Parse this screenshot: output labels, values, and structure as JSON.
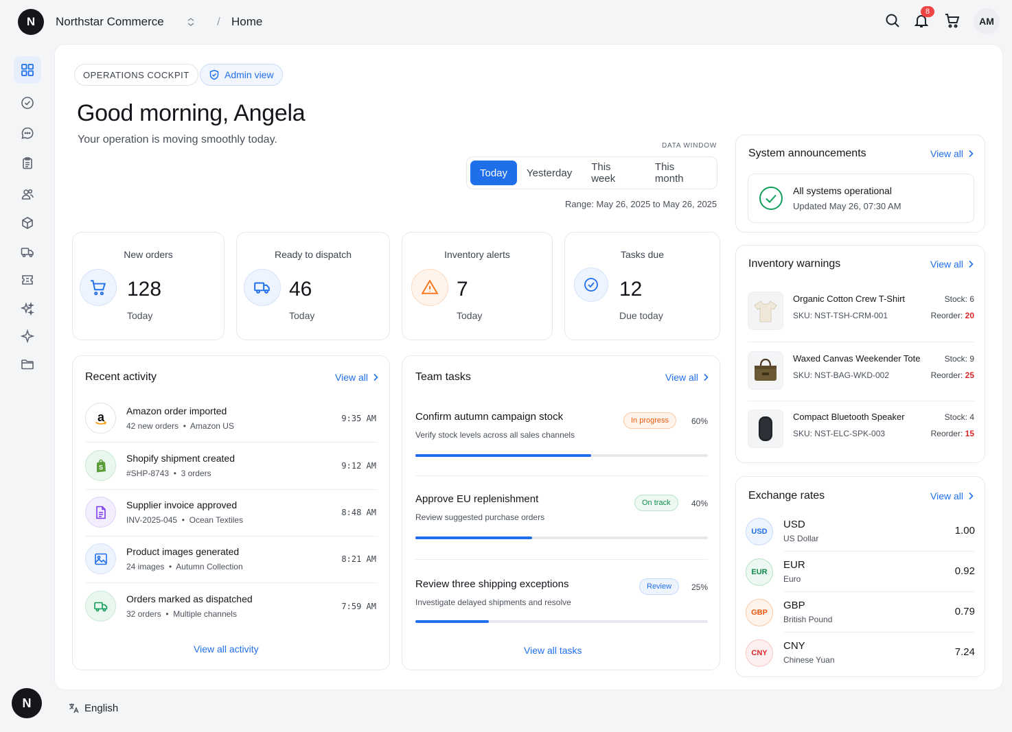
{
  "topbar": {
    "logo_letter": "N",
    "brand": "Northstar Commerce",
    "crumb_sep": "/",
    "crumb": "Home",
    "notif_count": "8",
    "avatar": "AM"
  },
  "sidebar": {
    "items": [
      {
        "icon": "dashboard-icon",
        "active": true
      },
      {
        "icon": "check-circle-icon"
      },
      {
        "icon": "chat-icon"
      },
      {
        "icon": "clipboard-icon"
      },
      {
        "icon": "users-icon"
      },
      {
        "icon": "box-icon"
      },
      {
        "icon": "truck-icon"
      },
      {
        "icon": "ticket-icon"
      },
      {
        "icon": "sparkles-icon"
      },
      {
        "icon": "sparkle-icon"
      },
      {
        "icon": "folder-icon"
      }
    ],
    "footer_logo": "N",
    "language": "English"
  },
  "header": {
    "ops_pill": "OPERATIONS COCKPIT",
    "admin_pill": "Admin view",
    "greeting": "Good morning, Angela",
    "subtitle": "Your operation is moving smoothly today.",
    "data_window_label": "DATA WINDOW",
    "tabs": [
      "Today",
      "Yesterday",
      "This week",
      "This month"
    ],
    "active_tab": "Today",
    "range": "Range: May 26, 2025 to May 26, 2025"
  },
  "stats": [
    {
      "label": "New orders",
      "value": "128",
      "foot": "Today",
      "icon": "cart-icon",
      "color": "#1f6feb"
    },
    {
      "label": "Ready to dispatch",
      "value": "46",
      "foot": "Today",
      "icon": "truck-icon",
      "color": "#1f6feb"
    },
    {
      "label": "Inventory alerts",
      "value": "7",
      "foot": "Today",
      "icon": "warning-icon",
      "color": "#f97316"
    },
    {
      "label": "Tasks due",
      "value": "12",
      "foot": "Due today",
      "icon": "check-circle-icon",
      "color": "#1f6feb"
    }
  ],
  "activity": {
    "title": "Recent activity",
    "view_all": "View all",
    "items": [
      {
        "title": "Amazon order imported",
        "meta1": "42 new orders",
        "meta2": "Amazon US",
        "time": "9:35 AM",
        "icon": "amazon-icon"
      },
      {
        "title": "Shopify shipment created",
        "meta1": "#SHP-8743",
        "meta2": "3 orders",
        "time": "9:12 AM",
        "icon": "shopify-icon"
      },
      {
        "title": "Supplier invoice approved",
        "meta1": "INV-2025-045",
        "meta2": "Ocean Textiles",
        "time": "8:48 AM",
        "icon": "document-icon"
      },
      {
        "title": "Product images generated",
        "meta1": "24 images",
        "meta2": "Autumn Collection",
        "time": "8:21 AM",
        "icon": "image-icon"
      },
      {
        "title": "Orders marked as dispatched",
        "meta1": "32 orders",
        "meta2": "Multiple channels",
        "time": "7:59 AM",
        "icon": "truck-icon"
      }
    ],
    "footer_link": "View all activity"
  },
  "tasks": {
    "title": "Team tasks",
    "view_all": "View all",
    "items": [
      {
        "title": "Confirm autumn campaign stock",
        "desc": "Verify stock levels across all sales channels",
        "badge": "In progress",
        "pct": "60%",
        "progress": 0.6
      },
      {
        "title": "Approve EU replenishment",
        "desc": "Review suggested purchase orders",
        "badge": "On track",
        "pct": "40%",
        "progress": 0.4
      },
      {
        "title": "Review three shipping exceptions",
        "desc": "Investigate delayed shipments and resolve",
        "badge": "Review",
        "pct": "25%",
        "progress": 0.25
      }
    ],
    "footer_link": "View all tasks"
  },
  "announcements": {
    "title": "System announcements",
    "view_all": "View all",
    "status": "All systems operational",
    "updated": "Updated May 26, 07:30 AM"
  },
  "inventory": {
    "title": "Inventory warnings",
    "view_all": "View all",
    "stock_label": "Stock:",
    "reorder_label": "Reorder:",
    "items": [
      {
        "name": "Organic Cotton Crew T-Shirt",
        "sku": "SKU: NST-TSH-CRM-001",
        "stock": "6",
        "reorder": "20",
        "thumb": "tshirt-icon"
      },
      {
        "name": "Waxed Canvas Weekender Tote",
        "sku": "SKU: NST-BAG-WKD-002",
        "stock": "9",
        "reorder": "25",
        "thumb": "bag-icon"
      },
      {
        "name": "Compact Bluetooth Speaker",
        "sku": "SKU: NST-ELC-SPK-003",
        "stock": "4",
        "reorder": "15",
        "thumb": "speaker-icon"
      }
    ]
  },
  "rates": {
    "title": "Exchange rates",
    "view_all": "View all",
    "items": [
      {
        "code": "USD",
        "name": "US Dollar",
        "value": "1.00",
        "color": "#1f6feb"
      },
      {
        "code": "EUR",
        "name": "Euro",
        "value": "0.92",
        "color": "#0f9d58"
      },
      {
        "code": "GBP",
        "name": "British Pound",
        "value": "0.79",
        "color": "#f97316"
      },
      {
        "code": "CNY",
        "name": "Chinese Yuan",
        "value": "7.24",
        "color": "#dc2626"
      }
    ]
  }
}
